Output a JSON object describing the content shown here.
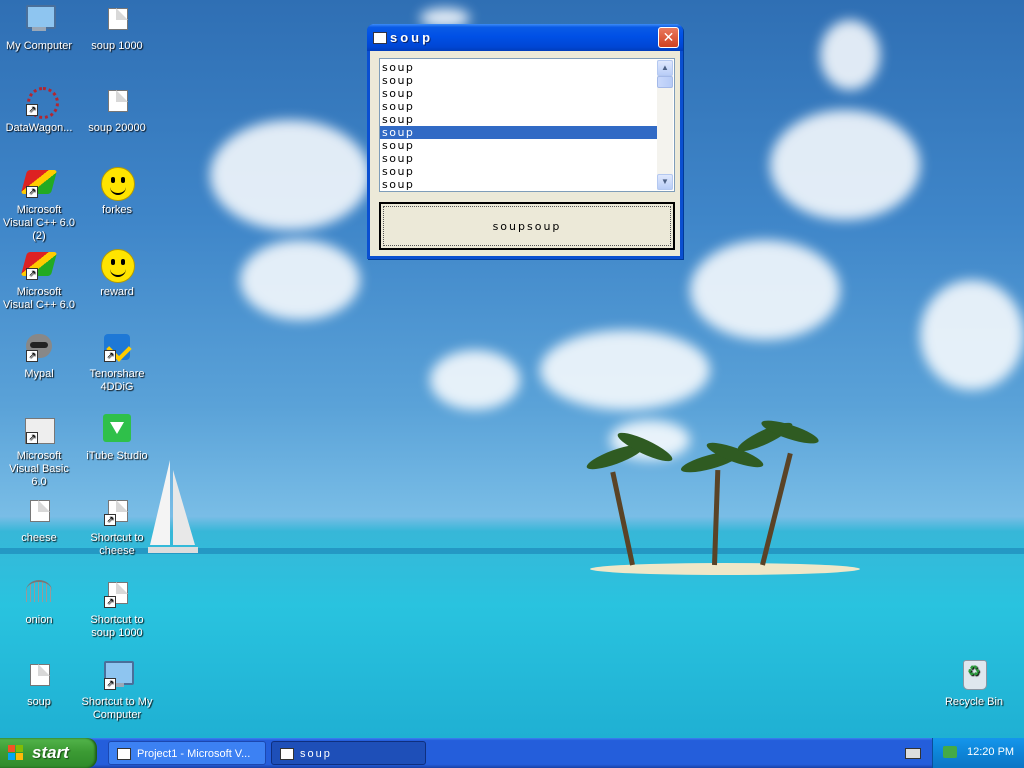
{
  "desktop": {
    "icons": [
      {
        "id": "my-computer",
        "label": "My Computer"
      },
      {
        "id": "soup-1000",
        "label": "soup 1000"
      },
      {
        "id": "datawagon",
        "label": "DataWagon..."
      },
      {
        "id": "soup-20000",
        "label": "soup 20000"
      },
      {
        "id": "msvc6-2",
        "label": "Microsoft Visual C++ 6.0 (2)"
      },
      {
        "id": "forkes",
        "label": "forkes"
      },
      {
        "id": "msvc6",
        "label": "Microsoft Visual C++ 6.0"
      },
      {
        "id": "reward",
        "label": "reward"
      },
      {
        "id": "mypal",
        "label": "Mypal"
      },
      {
        "id": "tenorshare",
        "label": "Tenorshare 4DDiG"
      },
      {
        "id": "msvb6",
        "label": "Microsoft Visual Basic 6.0"
      },
      {
        "id": "itube",
        "label": "iTube Studio"
      },
      {
        "id": "cheese",
        "label": "cheese"
      },
      {
        "id": "shortcut-cheese",
        "label": "Shortcut to cheese"
      },
      {
        "id": "onion",
        "label": "onion"
      },
      {
        "id": "shortcut-soup1000",
        "label": "Shortcut to soup 1000"
      },
      {
        "id": "soup",
        "label": "soup"
      },
      {
        "id": "shortcut-mycomputer",
        "label": "Shortcut to My Computer"
      },
      {
        "id": "recycle-bin",
        "label": "Recycle Bin"
      }
    ]
  },
  "dialog": {
    "title": "soup",
    "close_symbol": "✕",
    "list_items": [
      "soup",
      "soup",
      "soup",
      "soup",
      "soup",
      "soup",
      "soup",
      "soup",
      "soup",
      "soup"
    ],
    "selected_index": 5,
    "button_label": "soupsoup",
    "scroll_up_symbol": "▲",
    "scroll_down_symbol": "▼"
  },
  "taskbar": {
    "start_label": "start",
    "tasks": [
      {
        "label": "Project1 - Microsoft V..."
      },
      {
        "label": "soup"
      }
    ],
    "clock": "12:20 PM"
  },
  "colors": {
    "title_bar": "#0050e6",
    "selection": "#316ac5",
    "start_button": "#3c9b34",
    "taskbar": "#245edb"
  }
}
